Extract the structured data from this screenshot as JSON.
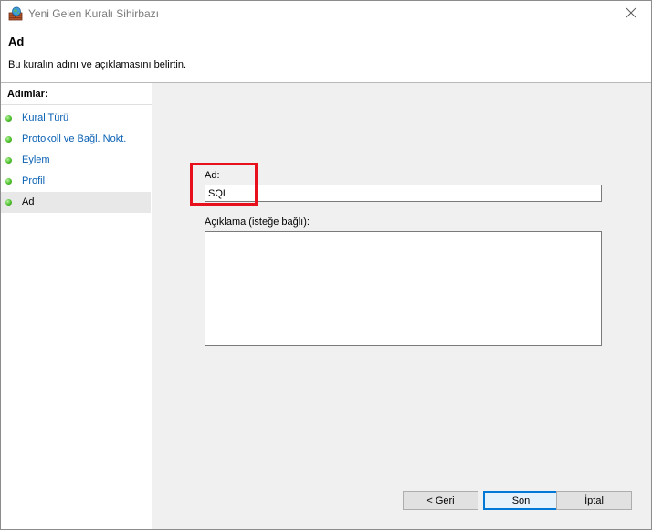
{
  "window": {
    "title": "Yeni Gelen Kuralı Sihirbazı",
    "close_glyph": "✕"
  },
  "header": {
    "title": "Ad",
    "description": "Bu kuralın adını ve açıklamasını belirtin."
  },
  "steps": {
    "title": "Adımlar:",
    "items": [
      {
        "label": "Kural Türü",
        "active": false
      },
      {
        "label": "Protokoll ve Bağl. Nokt.",
        "active": false
      },
      {
        "label": "Eylem",
        "active": false
      },
      {
        "label": "Profil",
        "active": false
      },
      {
        "label": "Ad",
        "active": true
      }
    ]
  },
  "form": {
    "name_label": "Ad:",
    "name_value": "SQL",
    "description_label": "Açıklama (isteğe bağlı):",
    "description_value": ""
  },
  "buttons": {
    "back": "< Geri",
    "finish": "Son",
    "cancel": "İptal"
  },
  "colors": {
    "highlight": "#e8101c",
    "link": "#0a61b4",
    "step_dot": "#4cbf2a"
  },
  "icons": {
    "app": "firewall-globe-icon",
    "close": "close-icon",
    "step": "green-dot-icon"
  }
}
